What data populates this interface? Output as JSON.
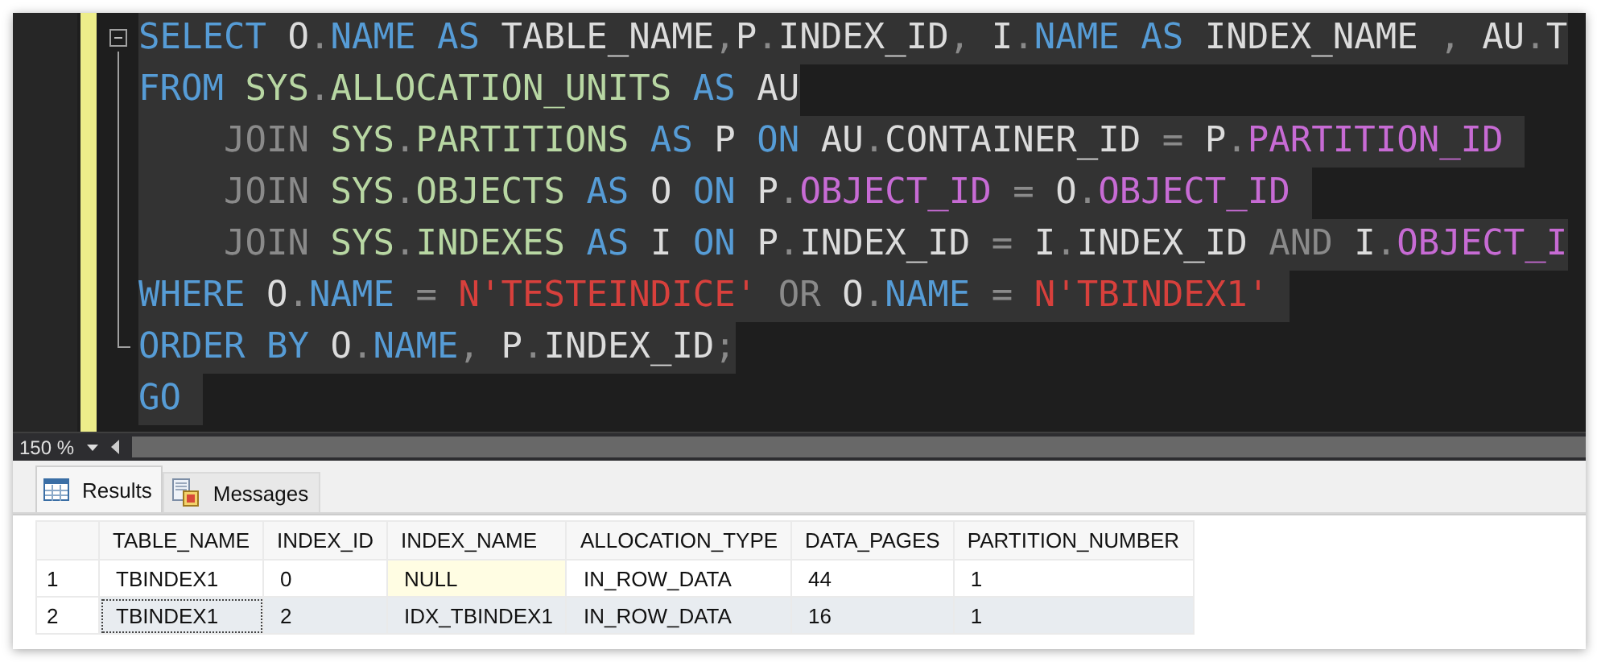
{
  "editor": {
    "lines": [
      {
        "selected": true,
        "kind": "start",
        "tokens": [
          {
            "kind": "kw",
            "text": "SELECT "
          },
          {
            "kind": "id",
            "text": "O"
          },
          {
            "kind": "op",
            "text": "."
          },
          {
            "kind": "kw",
            "text": "NAME "
          },
          {
            "kind": "kw",
            "text": "AS "
          },
          {
            "kind": "id",
            "text": "TABLE_NAME"
          },
          {
            "kind": "op",
            "text": ","
          },
          {
            "kind": "id",
            "text": "P"
          },
          {
            "kind": "op",
            "text": "."
          },
          {
            "kind": "id",
            "text": "INDEX_ID"
          },
          {
            "kind": "op",
            "text": ", "
          },
          {
            "kind": "id",
            "text": "I"
          },
          {
            "kind": "op",
            "text": "."
          },
          {
            "kind": "kw",
            "text": "NAME "
          },
          {
            "kind": "kw",
            "text": "AS "
          },
          {
            "kind": "id",
            "text": "INDEX_NAME "
          },
          {
            "kind": "op",
            "text": ", "
          },
          {
            "kind": "id",
            "text": "AU"
          },
          {
            "kind": "op",
            "text": "."
          },
          {
            "kind": "id",
            "text": "T"
          }
        ]
      },
      {
        "selected": true,
        "kind": "mid",
        "tokens": [
          {
            "kind": "kw",
            "text": "FROM "
          },
          {
            "kind": "sys",
            "text": "SYS"
          },
          {
            "kind": "op",
            "text": "."
          },
          {
            "kind": "sys",
            "text": "ALLOCATION_UNITS "
          },
          {
            "kind": "kw",
            "text": "AS "
          },
          {
            "kind": "id",
            "text": "AU"
          }
        ]
      },
      {
        "selected": true,
        "kind": "mid",
        "tokens": [
          {
            "kind": "op",
            "text": "    JOIN "
          },
          {
            "kind": "sys",
            "text": "SYS"
          },
          {
            "kind": "op",
            "text": "."
          },
          {
            "kind": "sys",
            "text": "PARTITIONS "
          },
          {
            "kind": "kw",
            "text": "AS "
          },
          {
            "kind": "id",
            "text": "P "
          },
          {
            "kind": "kw",
            "text": "ON "
          },
          {
            "kind": "id",
            "text": "AU"
          },
          {
            "kind": "op",
            "text": "."
          },
          {
            "kind": "id",
            "text": "CONTAINER_ID "
          },
          {
            "kind": "op",
            "text": "= "
          },
          {
            "kind": "id",
            "text": "P"
          },
          {
            "kind": "op",
            "text": "."
          },
          {
            "kind": "col",
            "text": "PARTITION_ID "
          }
        ]
      },
      {
        "selected": true,
        "kind": "mid",
        "tokens": [
          {
            "kind": "op",
            "text": "    JOIN "
          },
          {
            "kind": "sys",
            "text": "SYS"
          },
          {
            "kind": "op",
            "text": "."
          },
          {
            "kind": "sys",
            "text": "OBJECTS "
          },
          {
            "kind": "kw",
            "text": "AS "
          },
          {
            "kind": "id",
            "text": "O "
          },
          {
            "kind": "kw",
            "text": "ON "
          },
          {
            "kind": "id",
            "text": "P"
          },
          {
            "kind": "op",
            "text": "."
          },
          {
            "kind": "col",
            "text": "OBJECT_ID "
          },
          {
            "kind": "op",
            "text": "= "
          },
          {
            "kind": "id",
            "text": "O"
          },
          {
            "kind": "op",
            "text": "."
          },
          {
            "kind": "col",
            "text": "OBJECT_ID "
          }
        ]
      },
      {
        "selected": true,
        "kind": "mid",
        "tokens": [
          {
            "kind": "op",
            "text": "    JOIN "
          },
          {
            "kind": "sys",
            "text": "SYS"
          },
          {
            "kind": "op",
            "text": "."
          },
          {
            "kind": "sys",
            "text": "INDEXES "
          },
          {
            "kind": "kw",
            "text": "AS "
          },
          {
            "kind": "id",
            "text": "I "
          },
          {
            "kind": "kw",
            "text": "ON "
          },
          {
            "kind": "id",
            "text": "P"
          },
          {
            "kind": "op",
            "text": "."
          },
          {
            "kind": "id",
            "text": "INDEX_ID "
          },
          {
            "kind": "op",
            "text": "= "
          },
          {
            "kind": "id",
            "text": "I"
          },
          {
            "kind": "op",
            "text": "."
          },
          {
            "kind": "id",
            "text": "INDEX_ID "
          },
          {
            "kind": "op",
            "text": "AND "
          },
          {
            "kind": "id",
            "text": "I"
          },
          {
            "kind": "op",
            "text": "."
          },
          {
            "kind": "col",
            "text": "OBJECT_I"
          }
        ]
      },
      {
        "selected": true,
        "kind": "mid",
        "tokens": [
          {
            "kind": "kw",
            "text": "WHERE "
          },
          {
            "kind": "id",
            "text": "O"
          },
          {
            "kind": "op",
            "text": "."
          },
          {
            "kind": "kw",
            "text": "NAME "
          },
          {
            "kind": "op",
            "text": "= "
          },
          {
            "kind": "str",
            "text": "N'TESTEINDICE' "
          },
          {
            "kind": "op",
            "text": "OR "
          },
          {
            "kind": "id",
            "text": "O"
          },
          {
            "kind": "op",
            "text": "."
          },
          {
            "kind": "kw",
            "text": "NAME "
          },
          {
            "kind": "op",
            "text": "= "
          },
          {
            "kind": "str",
            "text": "N'TBINDEX1' "
          }
        ]
      },
      {
        "selected": true,
        "kind": "end",
        "tokens": [
          {
            "kind": "kw",
            "text": "ORDER "
          },
          {
            "kind": "kw",
            "text": "BY "
          },
          {
            "kind": "id",
            "text": "O"
          },
          {
            "kind": "op",
            "text": "."
          },
          {
            "kind": "kw",
            "text": "NAME"
          },
          {
            "kind": "op",
            "text": ", "
          },
          {
            "kind": "id",
            "text": "P"
          },
          {
            "kind": "op",
            "text": "."
          },
          {
            "kind": "id",
            "text": "INDEX_ID"
          },
          {
            "kind": "op",
            "text": ";"
          }
        ]
      },
      {
        "selected": true,
        "kind": "plain",
        "tokens": [
          {
            "kind": "kw",
            "text": "GO "
          }
        ]
      }
    ]
  },
  "zoom": "150 %",
  "tabs": [
    {
      "label": "Results",
      "selected": true
    },
    {
      "label": "Messages",
      "selected": false
    }
  ],
  "table": {
    "columns": [
      "TABLE_NAME",
      "INDEX_ID",
      "INDEX_NAME",
      "ALLOCATION_TYPE",
      "DATA_PAGES",
      "PARTITION_NUMBER"
    ],
    "rows": [
      {
        "number": "1",
        "selected": false,
        "cells": [
          {
            "text": "TBINDEX1",
            "kind": "value",
            "focused": false
          },
          {
            "text": "0",
            "kind": "value",
            "focused": false
          },
          {
            "text": "NULL",
            "kind": "null",
            "focused": false
          },
          {
            "text": "IN_ROW_DATA",
            "kind": "value",
            "focused": false
          },
          {
            "text": "44",
            "kind": "value",
            "focused": false
          },
          {
            "text": "1",
            "kind": "value",
            "focused": false
          }
        ]
      },
      {
        "number": "2",
        "selected": true,
        "cells": [
          {
            "text": "TBINDEX1",
            "kind": "value",
            "focused": true
          },
          {
            "text": "2",
            "kind": "value",
            "focused": false
          },
          {
            "text": "IDX_TBINDEX1",
            "kind": "value",
            "focused": false
          },
          {
            "text": "IN_ROW_DATA",
            "kind": "value",
            "focused": false
          },
          {
            "text": "16",
            "kind": "value",
            "focused": false
          },
          {
            "text": "1",
            "kind": "value",
            "focused": false
          }
        ]
      }
    ]
  }
}
